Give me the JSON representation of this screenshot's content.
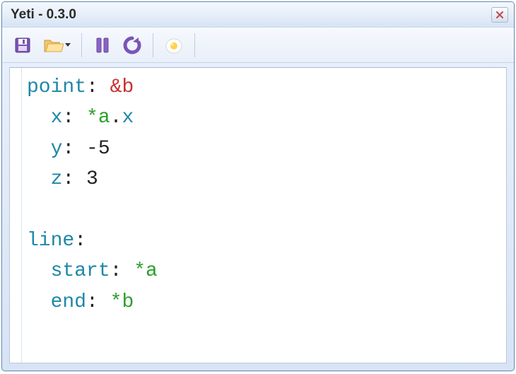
{
  "window": {
    "title": "Yeti - 0.3.0"
  },
  "icons": {
    "save": "save-icon",
    "open": "open-folder-icon",
    "pause": "pause-icon",
    "reload": "reload-icon",
    "egg": "egg-icon",
    "close": "close-icon"
  },
  "code": {
    "l1_key": "point",
    "l1_anchor": "&b",
    "l2_key": "x",
    "l2_ref": "*a",
    "l2_dot": ".",
    "l2_prop": "x",
    "l3_key": "y",
    "l3_val": "-5",
    "l4_key": "z",
    "l4_val": "3",
    "l6_key": "line",
    "l7_key": "start",
    "l7_ref": "*a",
    "l8_key": "end",
    "l8_ref": "*b",
    "colon": ":",
    "space": " ",
    "indent": "  "
  }
}
